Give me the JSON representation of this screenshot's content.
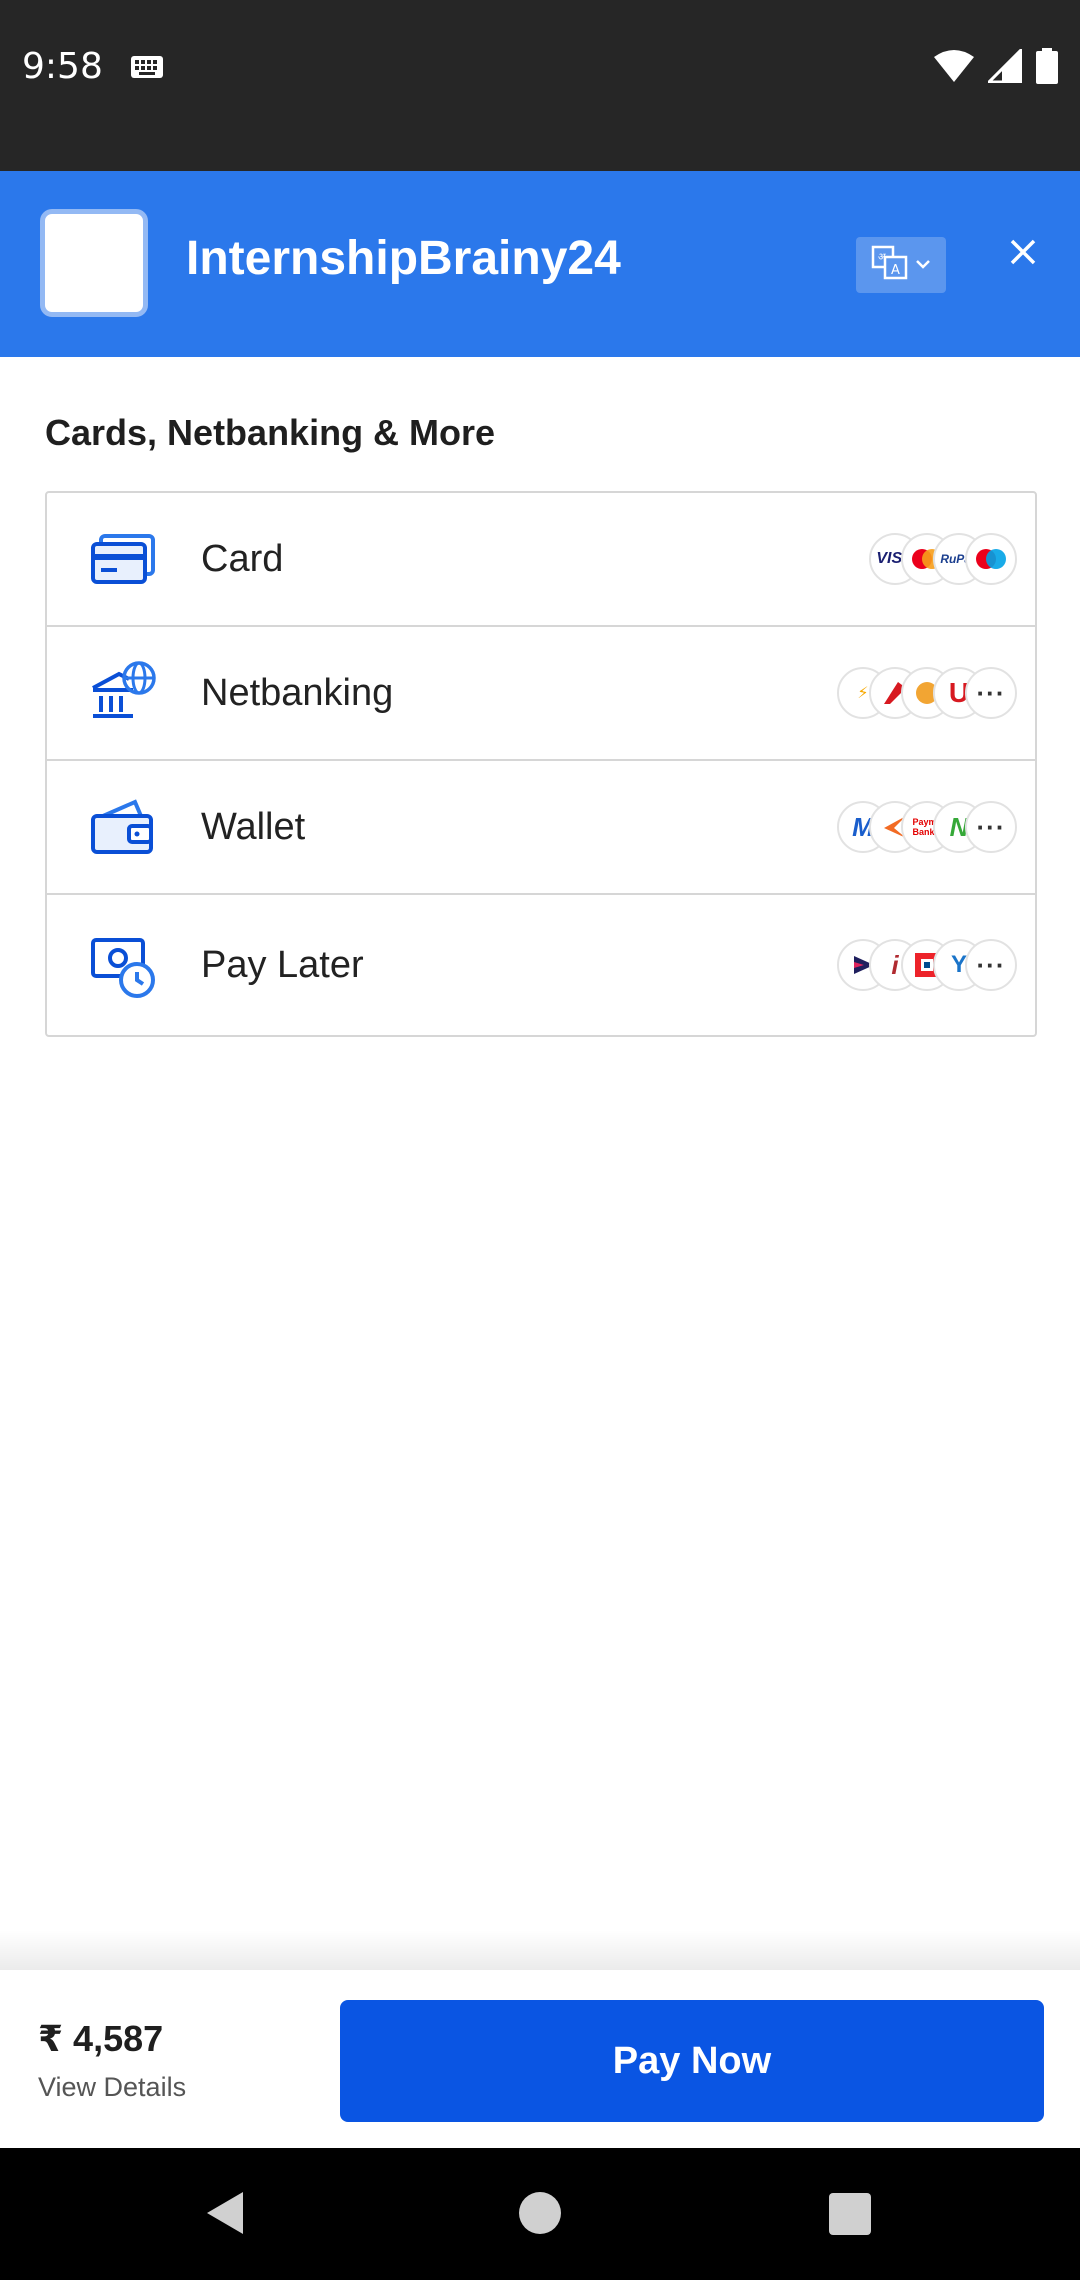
{
  "status_bar": {
    "time": "9:58"
  },
  "header": {
    "merchant_name": "InternshipBrainy24"
  },
  "section_title": "Cards, Netbanking & More",
  "methods": [
    {
      "label": "Card",
      "icon": "card-icon",
      "badges": [
        "VISA",
        "mc",
        "RuPay",
        "maestro"
      ]
    },
    {
      "label": "Netbanking",
      "icon": "bank-globe-icon",
      "badges": [
        "SBI",
        "axis",
        "canara",
        "union",
        "more"
      ]
    },
    {
      "label": "Wallet",
      "icon": "wallet-icon",
      "badges": [
        "M",
        "freecharge",
        "Payme Bank",
        "N",
        "more"
      ]
    },
    {
      "label": "Pay Later",
      "icon": "calendar-clock-icon",
      "badges": [
        "play",
        "ICICI",
        "HDFC",
        "Y",
        "more"
      ]
    }
  ],
  "footer": {
    "amount": "₹ 4,587",
    "view_details": "View Details",
    "pay_label": "Pay Now"
  },
  "colors": {
    "header_bg": "#2b78eb",
    "primary_button": "#0a55e3",
    "statusbar_bg": "#262626"
  }
}
